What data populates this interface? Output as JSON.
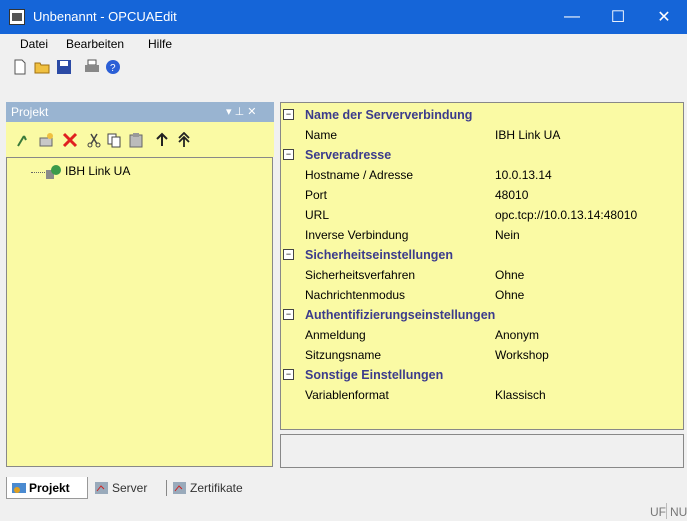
{
  "window": {
    "title": "Unbenannt - OPCUAEdit",
    "minimize": "—",
    "maximize": "☐",
    "close": "✕"
  },
  "menu": [
    "Datei",
    "Bearbeiten",
    "Hilfe"
  ],
  "toolbar_icons": [
    "new-file-icon",
    "open-folder-icon",
    "save-icon",
    "print-icon",
    "help-icon"
  ],
  "pane": {
    "title": "Projekt",
    "pin": "▾ ⊥ ✕",
    "tree_item": "IBH Link UA",
    "tabs": [
      "Projekt",
      "Server",
      "Zertifikate"
    ]
  },
  "properties": {
    "cat1": "Name der Serververbindung",
    "name_label": "Name",
    "name_value": "IBH Link UA",
    "cat2": "Serveradresse",
    "host_label": "Hostname / Adresse",
    "host_value": "10.0.13.14",
    "port_label": "Port",
    "port_value": "48010",
    "url_label": "URL",
    "url_value": "opc.tcp://10.0.13.14:48010",
    "inv_label": "Inverse Verbindung",
    "inv_value": "Nein",
    "cat3": "Sicherheitseinstellungen",
    "sec_label": "Sicherheitsverfahren",
    "sec_value": "Ohne",
    "msg_label": "Nachrichtenmodus",
    "msg_value": "Ohne",
    "cat4": "Authentifizierungseinstellungen",
    "login_label": "Anmeldung",
    "login_value": "Anonym",
    "session_label": "Sitzungsname",
    "session_value": "Workshop",
    "cat5": "Sonstige Einstellungen",
    "var_label": "Variablenformat",
    "var_value": "Klassisch"
  },
  "status": {
    "uf": "UF",
    "num": "NUM"
  },
  "colors": {
    "titlebar": "#1565d8",
    "grid_bg": "#fafaa4",
    "category_text": "#3b3b8c"
  }
}
